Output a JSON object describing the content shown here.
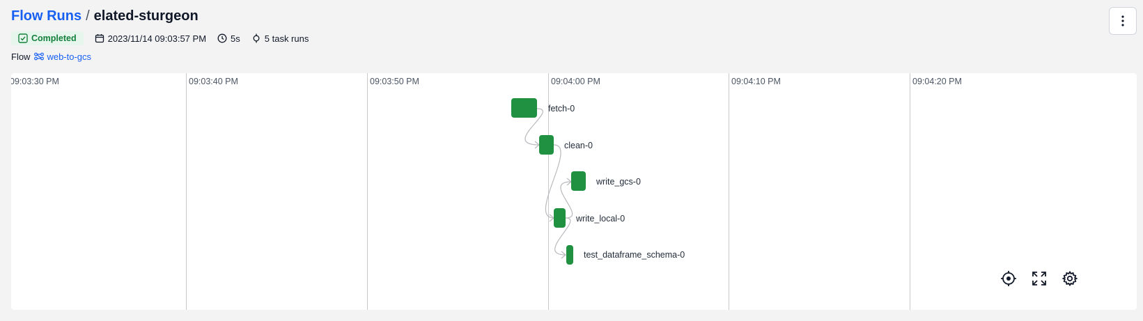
{
  "breadcrumb": {
    "parent": "Flow Runs",
    "separator": "/",
    "current": "elated-sturgeon"
  },
  "status": {
    "label": "Completed",
    "color": "#15803d"
  },
  "meta": {
    "start_time": "2023/11/14 09:03:57 PM",
    "duration": "5s",
    "task_runs": "5 task runs"
  },
  "flow": {
    "label": "Flow",
    "name": "web-to-gcs"
  },
  "timeline": {
    "ticks": [
      "09:03:30 PM",
      "09:03:40 PM",
      "09:03:50 PM",
      "09:04:00 PM",
      "09:04:10 PM",
      "09:04:20 PM"
    ],
    "tasks": [
      {
        "name": "fetch-0",
        "state": "Completed"
      },
      {
        "name": "clean-0",
        "state": "Completed"
      },
      {
        "name": "write_gcs-0",
        "state": "Completed"
      },
      {
        "name": "write_local-0",
        "state": "Completed"
      },
      {
        "name": "test_dataframe_schema-0",
        "state": "Completed"
      }
    ],
    "node_color": "#1f9140"
  },
  "icons": {
    "menu": "more-vertical-icon",
    "status": "check-square-icon",
    "calendar": "calendar-icon",
    "clock": "clock-icon",
    "tasks": "task-run-icon",
    "flow": "flow-icon",
    "center": "crosshair-icon",
    "fullscreen": "expand-icon",
    "settings": "gear-icon"
  }
}
